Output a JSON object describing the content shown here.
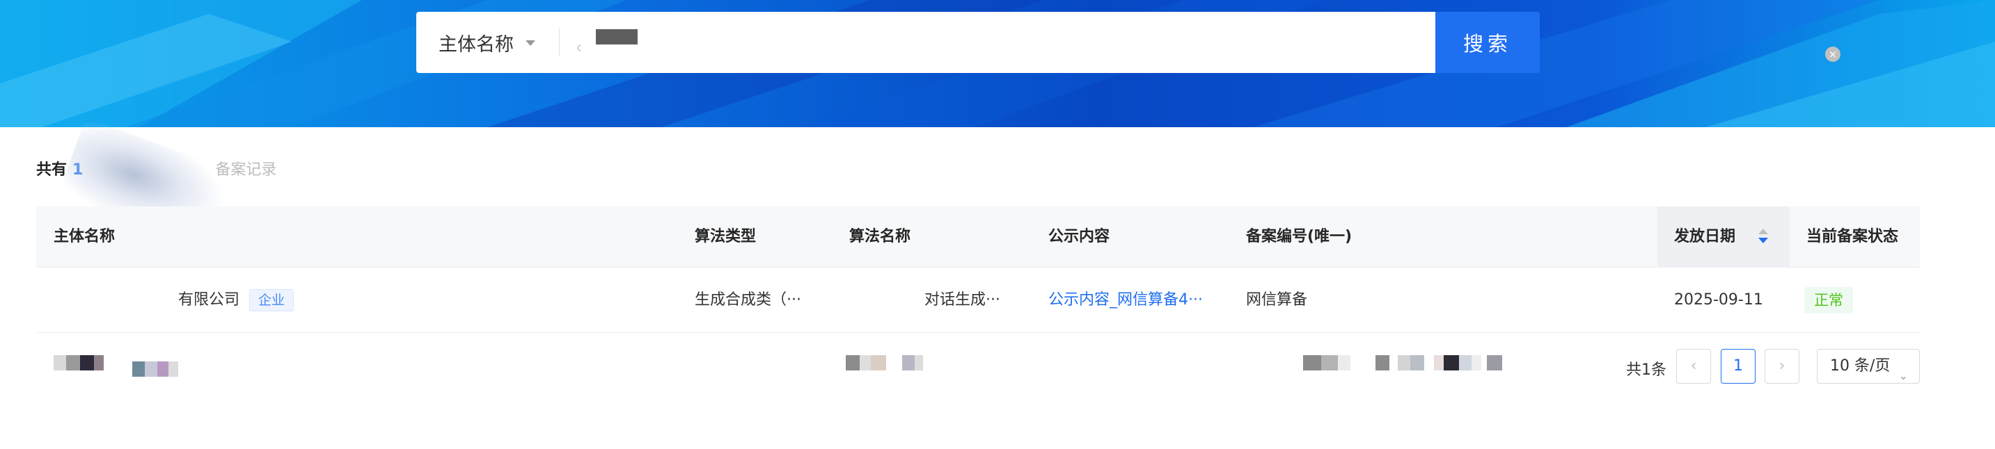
{
  "search": {
    "type_label": "主体名称",
    "clear_glyph": "×",
    "button_label": "搜索"
  },
  "summary": {
    "prefix": "共有",
    "count": "1",
    "suffix": "备案记录"
  },
  "table": {
    "headers": {
      "entity_name": "主体名称",
      "algo_type": "算法类型",
      "algo_name": "算法名称",
      "public_content": "公示内容",
      "filing_number": "备案编号(唯一)",
      "issue_date": "发放日期",
      "status": "当前备案状态"
    },
    "rows": [
      {
        "entity_suffix": "有限公司",
        "entity_tag": "企业",
        "algo_type": "生成合成类（···",
        "algo_name_suffix": "对话生成···",
        "public_content": "公示内容_网信算备4···",
        "filing_prefix": "网信算备",
        "issue_date": "2025-09-11",
        "status": "正常"
      }
    ]
  },
  "pagination": {
    "total": "共1条",
    "prev_glyph": "‹",
    "current_page": "1",
    "next_glyph": "›",
    "page_size": "10 条/页",
    "page_size_chevron": "⌄"
  },
  "colors": {
    "accent": "#1f6ff1",
    "status_ok": "#52c41a",
    "banner_dark": "#0747c4",
    "banner_light": "#0aa2ea"
  }
}
